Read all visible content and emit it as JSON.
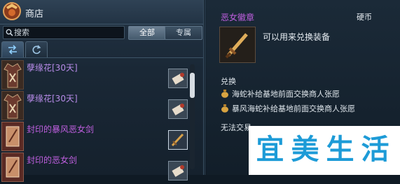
{
  "shop": {
    "title": "商店",
    "search_placeholder": "搜索",
    "filters": [
      {
        "label": "全部",
        "active": true
      },
      {
        "label": "专属",
        "active": false
      }
    ],
    "tabs": [
      {
        "icon": "exchange-arrows-icon",
        "active": true
      },
      {
        "icon": "refresh-icon",
        "active": false
      }
    ],
    "items": [
      {
        "name": "孽缘花[30天]",
        "color": "#b78be8",
        "icon": "clothing-icon",
        "cost_icon": "scroll-icon"
      },
      {
        "name": "孽缘花[30天]",
        "color": "#b78be8",
        "icon": "clothing-icon",
        "cost_icon": "scroll-icon"
      },
      {
        "name": "封印的暴风恶女剑",
        "color": "#c05fe0",
        "icon": "sealed-sword-icon",
        "cost_icon": "dagger-icon"
      },
      {
        "name": "封印的恶女剑",
        "color": "#c05fe0",
        "icon": "sealed-sword-icon",
        "cost_icon": "scroll-icon"
      }
    ]
  },
  "tooltip": {
    "title": "恶女徽章",
    "title_color": "#c05fe0",
    "type": "硬币",
    "description": "可以用来兑换装备",
    "exchange_label": "兑换",
    "exchange_items": [
      "海蛇补给基地前面交换商人张愿",
      "暴风海蛇补给基地前面交换商人张愿"
    ],
    "no_trade": "无法交易"
  },
  "watermark": {
    "chars": [
      "宜",
      "美",
      "生",
      "活"
    ],
    "color": "#1d9bd7"
  }
}
